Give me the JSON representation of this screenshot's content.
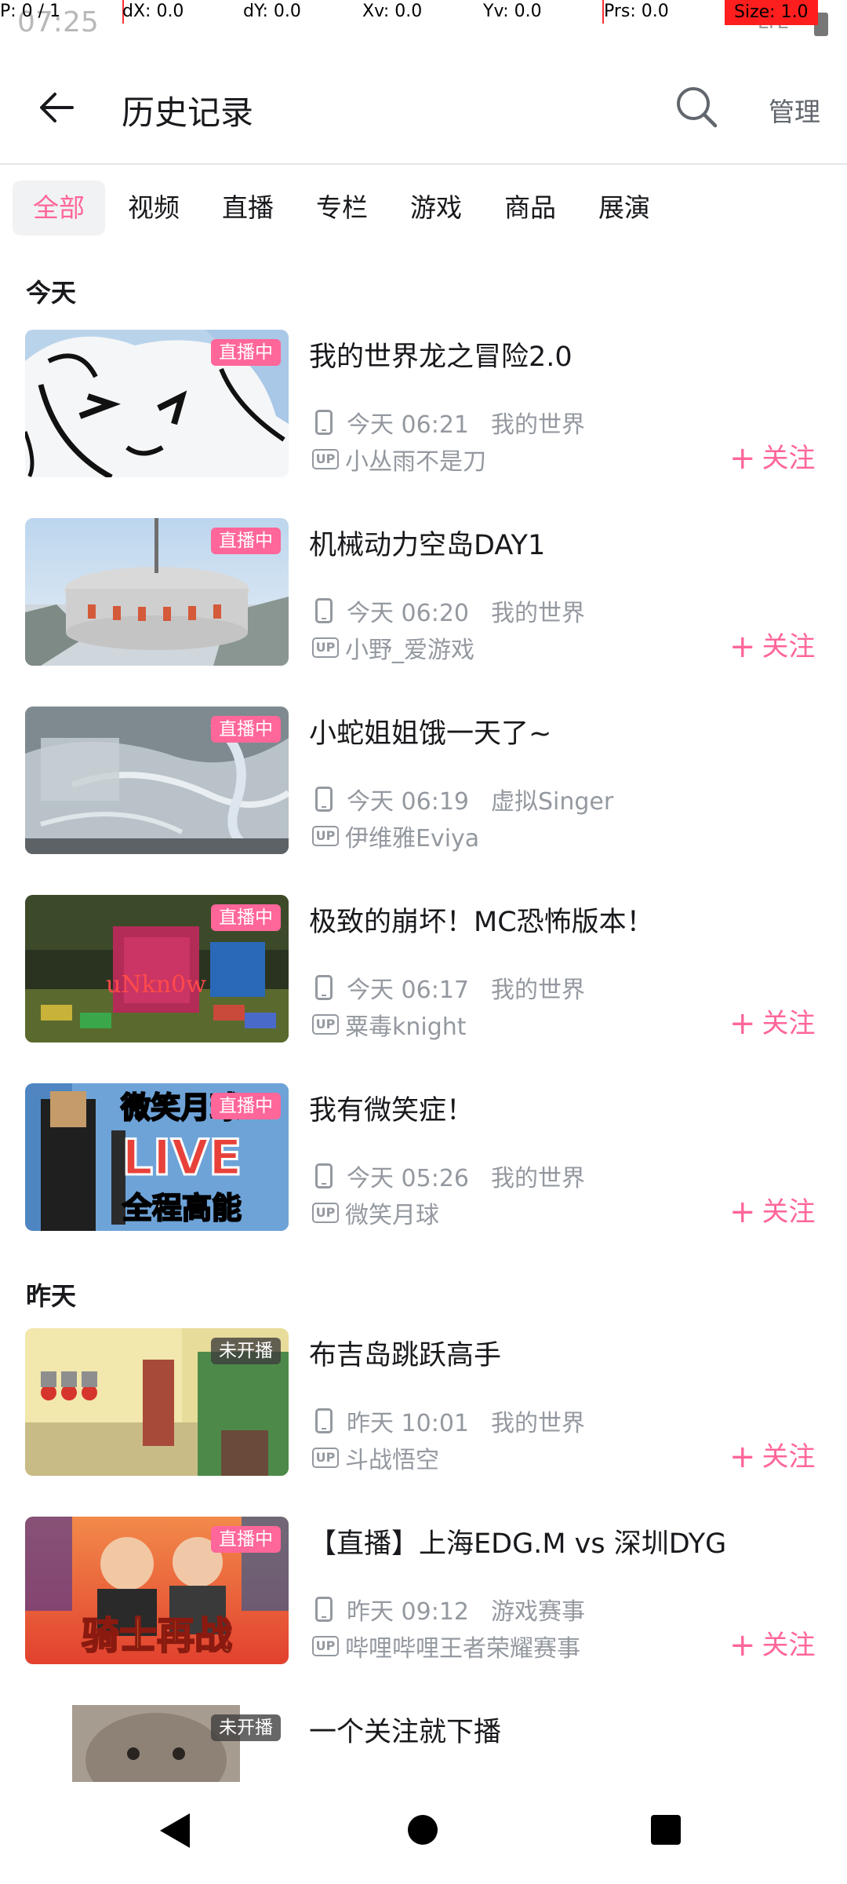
{
  "status": {
    "time": "07:25",
    "network": "LTE"
  },
  "debug": {
    "p": "P: 0 / 1",
    "dx": "dX: 0.0",
    "dy": "dY: 0.0",
    "xv": "Xv: 0.0",
    "yv": "Yv: 0.0",
    "prs": "Prs: 0.0",
    "size": "Size: 1.0"
  },
  "header": {
    "title": "历史记录",
    "manage": "管理"
  },
  "tabs": [
    "全部",
    "视频",
    "直播",
    "专栏",
    "游戏",
    "商品",
    "展演"
  ],
  "sections": {
    "today": "今天",
    "yesterday": "昨天"
  },
  "follow_label": "关注",
  "up_tag": "UP",
  "items": [
    {
      "title": "我的世界龙之冒险2.0",
      "badge": "直播中",
      "time": "今天 06:21",
      "category": "我的世界",
      "uploader": "小丛雨不是刀",
      "follow": true
    },
    {
      "title": "机械动力空岛DAY1",
      "badge": "直播中",
      "time": "今天 06:20",
      "category": "我的世界",
      "uploader": "小野_爱游戏",
      "follow": true
    },
    {
      "title": "小蛇姐姐饿一天了~",
      "badge": "直播中",
      "time": "今天 06:19",
      "category": "虚拟Singer",
      "uploader": "伊维雅Eviya",
      "follow": false
    },
    {
      "title": "极致的崩坏！MC恐怖版本！",
      "badge": "直播中",
      "time": "今天 06:17",
      "category": "我的世界",
      "uploader": "粟毒knight",
      "follow": true
    },
    {
      "title": "我有微笑症！",
      "badge": "直播中",
      "time": "今天 05:26",
      "category": "我的世界",
      "uploader": "微笑月球",
      "follow": true
    },
    {
      "title": "布吉岛跳跃高手",
      "badge": "未开播",
      "time": "昨天 10:01",
      "category": "我的世界",
      "uploader": "斗战悟空",
      "follow": true
    },
    {
      "title": "【直播】上海EDG.M vs 深圳DYG",
      "badge": "直播中",
      "time": "昨天 09:12",
      "category": "游戏赛事",
      "uploader": "哔哩哔哩王者荣耀赛事",
      "follow": true
    },
    {
      "title": "一个关注就下播",
      "badge": "未开播"
    }
  ],
  "thumb_text": {
    "item3": "uNkn0w",
    "item4_top": "微笑月球",
    "item4_mid": "LIVE",
    "item4_bottom": "全程高能",
    "item6": "骑士再战"
  },
  "colors": {
    "accent": "#ff6699",
    "text": "#18191c",
    "secondary": "#9499a0",
    "divider": "#e3e5e7"
  }
}
